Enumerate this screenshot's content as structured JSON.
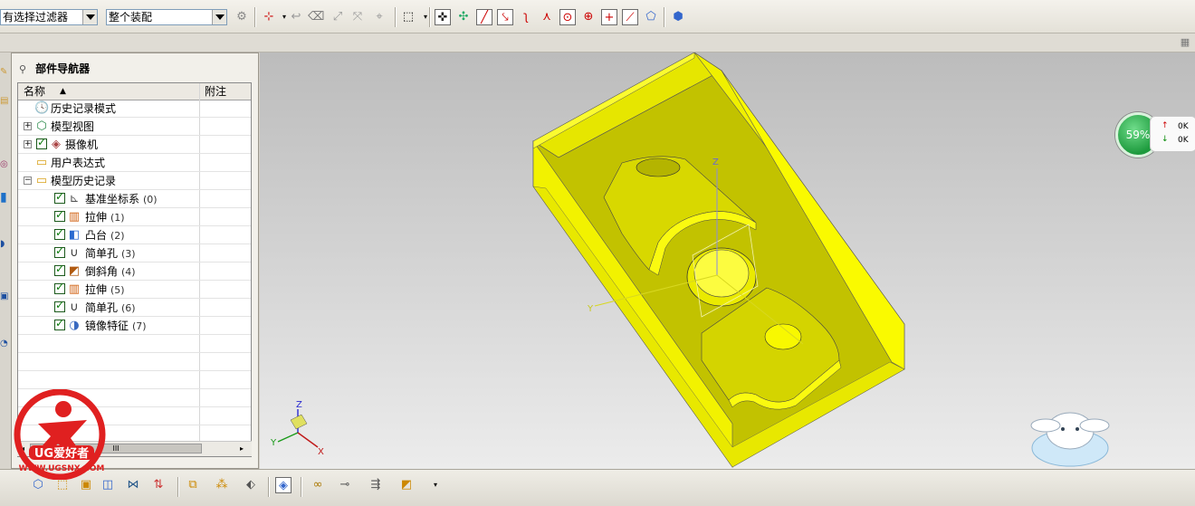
{
  "toolbar": {
    "filter_combo": "有选择过滤器",
    "scope_combo": "整个装配"
  },
  "navigator": {
    "title": "部件导航器",
    "columns": {
      "name": "名称",
      "note": "附注"
    },
    "rows": [
      {
        "label": "历史记录模式",
        "sub": "",
        "icon": "clock-icon"
      },
      {
        "label": "模型视图",
        "sub": "",
        "icon": "model-views-icon"
      },
      {
        "label": "摄像机",
        "sub": "",
        "icon": "camera-icon"
      },
      {
        "label": "用户表达式",
        "sub": "",
        "icon": "folder-icon"
      },
      {
        "label": "模型历史记录",
        "sub": "",
        "icon": "folder-open-icon"
      },
      {
        "label": "基准坐标系",
        "sub": "(0)",
        "icon": "datum-csys-icon"
      },
      {
        "label": "拉伸",
        "sub": "(1)",
        "icon": "extrude-icon"
      },
      {
        "label": "凸台",
        "sub": "(2)",
        "icon": "boss-icon"
      },
      {
        "label": "简单孔",
        "sub": "(3)",
        "icon": "simple-hole-icon"
      },
      {
        "label": "倒斜角",
        "sub": "(4)",
        "icon": "chamfer-icon"
      },
      {
        "label": "拉伸",
        "sub": "(5)",
        "icon": "extrude-icon"
      },
      {
        "label": "简单孔",
        "sub": "(6)",
        "icon": "simple-hole-icon"
      },
      {
        "label": "镜像特征",
        "sub": "(7)",
        "icon": "mirror-feature-icon"
      }
    ],
    "scroll_label": "III"
  },
  "viewport": {
    "triad_labels": {
      "z": "Z",
      "y": "Y",
      "x": "X"
    },
    "wcs_labels": {
      "z": "Z",
      "y": "Y"
    }
  },
  "gauge": {
    "percent": "59%",
    "up": "0K",
    "down": "0K"
  },
  "logo": {
    "text": "UG爱好者",
    "url": "WWW.UGSNX.COM"
  },
  "colors": {
    "part": "#f2f200",
    "part_shade": "#c8c800",
    "part_dark": "#9a9a00"
  }
}
